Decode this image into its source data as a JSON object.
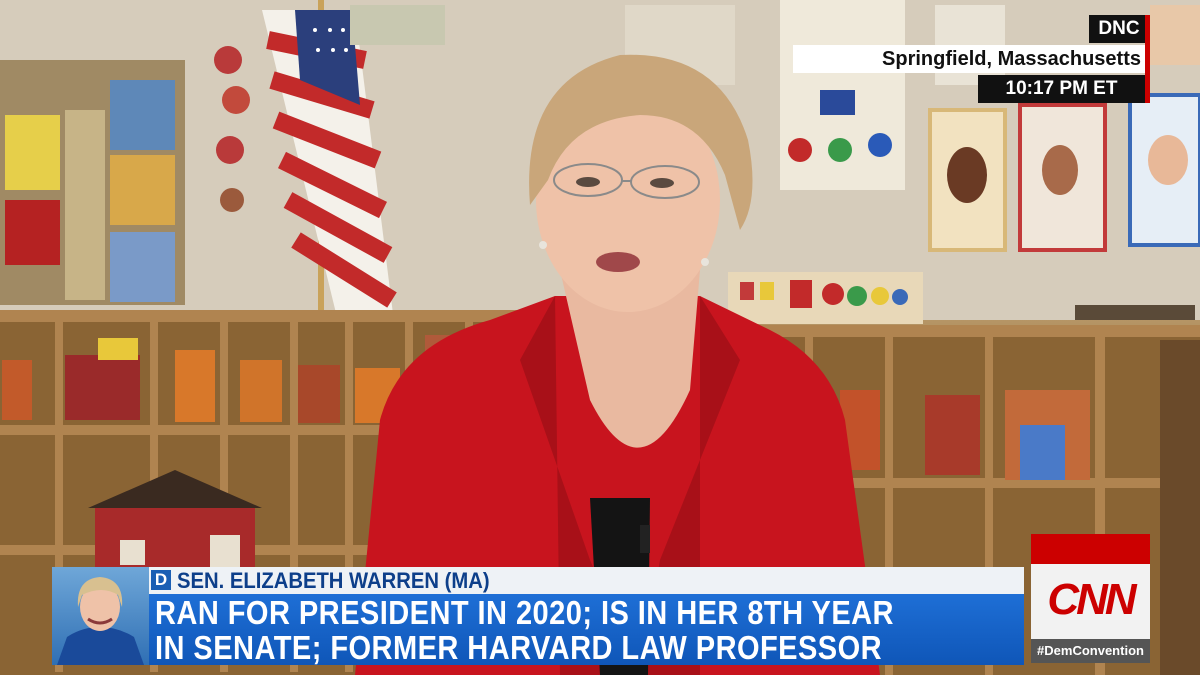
{
  "location_bug": {
    "network": "DNC",
    "city": "Springfield, Massachusetts",
    "time": "10:17 PM ET"
  },
  "lower_third": {
    "party": "D",
    "name": "SEN. ELIZABETH WARREN (MA)",
    "headline_line1": "RAN FOR PRESIDENT IN 2020; IS IN HER 8TH YEAR",
    "headline_line2": "IN SENATE; FORMER HARVARD LAW PROFESSOR"
  },
  "network_bug": {
    "logo": "CNN",
    "hashtag": "#DemConvention"
  },
  "colors": {
    "cnn_red": "#cc0000",
    "lower_third_blue": "#1563c8",
    "jacket_red": "#c8141e"
  }
}
